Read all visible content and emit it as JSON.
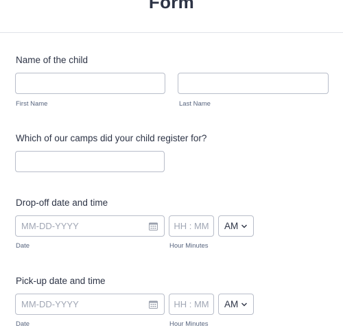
{
  "form": {
    "title": "Form"
  },
  "child_name": {
    "label": "Name of the child",
    "first": {
      "value": "",
      "placeholder": "",
      "sublabel": "First Name"
    },
    "last": {
      "value": "",
      "placeholder": "",
      "sublabel": "Last Name"
    }
  },
  "camp": {
    "label": "Which of our camps did your child register for?",
    "value": "",
    "placeholder": ""
  },
  "dropoff": {
    "label": "Drop-off date and time",
    "date_placeholder": "MM-DD-YYYY",
    "date_sublabel": "Date",
    "time_placeholder": "HH : MM",
    "time_sublabel": "Hour Minutes",
    "ampm": "AM"
  },
  "pickup": {
    "label": "Pick-up date and time",
    "date_placeholder": "MM-DD-YYYY",
    "date_sublabel": "Date",
    "time_placeholder": "HH : MM",
    "time_sublabel": "Hour Minutes",
    "ampm": "AM"
  },
  "icons": {
    "calendar": "calendar-icon",
    "dropdown": "chevron-down-icon"
  },
  "colors": {
    "text": "#2c3345",
    "sublabel": "#57647e",
    "border": "#b8bdc9",
    "placeholder": "#a0a6b4"
  }
}
